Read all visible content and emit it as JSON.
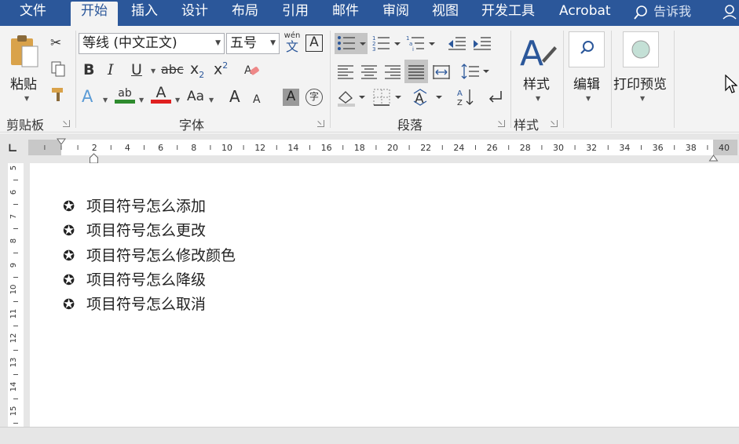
{
  "tabs": [
    "文件",
    "开始",
    "插入",
    "设计",
    "布局",
    "引用",
    "邮件",
    "审阅",
    "视图",
    "开发工具",
    "Acrobat"
  ],
  "tell_me": "告诉我",
  "clipboard": {
    "paste_label": "粘贴",
    "group_label": "剪贴板"
  },
  "font": {
    "name": "等线 (中文正文)",
    "size": "五号",
    "phonetic_top": "wén",
    "phonetic_bottom": "文",
    "bold": "B",
    "italic": "I",
    "underline": "U",
    "strike": "abc",
    "subscript": "x",
    "subscript_small": "2",
    "superscript": "x",
    "superscript_small": "2",
    "highlight_glyph": "ab",
    "font_color_glyph": "A",
    "case_glyph": "Aa",
    "grow": "A",
    "shrink": "A",
    "shade_glyph": "A",
    "enclose_glyph": "字",
    "group_label": "字体"
  },
  "paragraph": {
    "group_label": "段落"
  },
  "styles": {
    "label": "样式",
    "group_label": "样式"
  },
  "editing": {
    "label": "编辑"
  },
  "print_preview": {
    "label": "打印预览"
  },
  "ruler": {
    "h_numbers": [
      "2",
      "4",
      "6",
      "8",
      "10",
      "12",
      "14",
      "16",
      "18",
      "20",
      "22",
      "24",
      "26",
      "28",
      "30",
      "32",
      "34",
      "36",
      "38",
      "40"
    ],
    "v_numbers": [
      "5",
      "6",
      "7",
      "8",
      "9",
      "10",
      "11",
      "12",
      "13",
      "14",
      "15"
    ]
  },
  "document": {
    "bullet_glyph": "✪",
    "items": [
      "项目符号怎么添加",
      "项目符号怎么更改",
      "项目符号怎么修改颜色",
      "项目符号怎么降级",
      "项目符号怎么取消"
    ]
  },
  "colors": {
    "accent": "#2b579a",
    "highlight_green": "#2e8b2e",
    "font_red": "#e02020"
  }
}
